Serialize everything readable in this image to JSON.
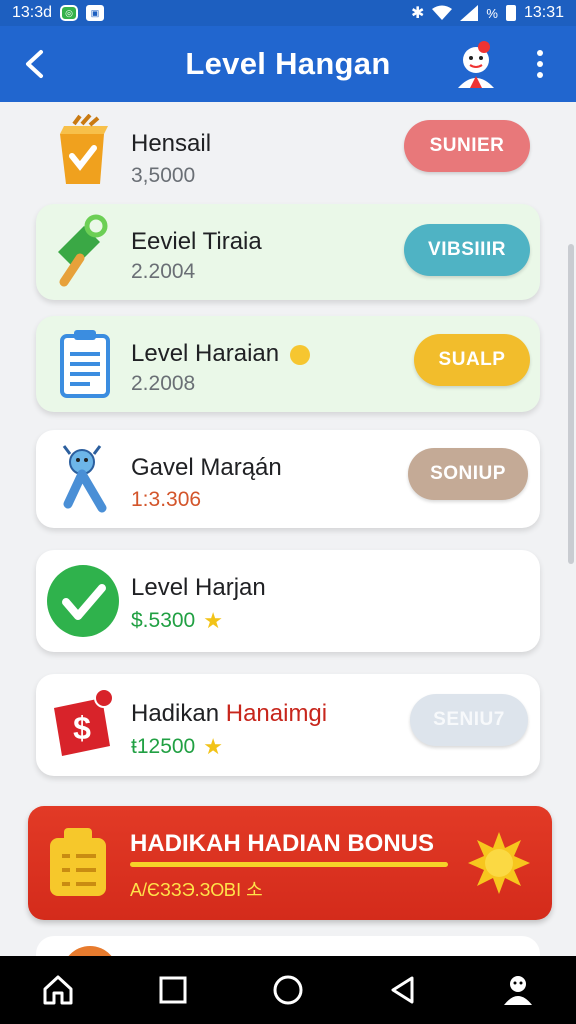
{
  "status_bar": {
    "time_left": "13:3d",
    "time_right": "13:31",
    "battery_text": "%"
  },
  "app_bar": {
    "title": "Level Hangan"
  },
  "cards": [
    {
      "title": "Hensail",
      "subtitle": "3,5000",
      "button": "SUNIER",
      "icon": "box-check-icon"
    },
    {
      "title": "Eeviel Tiraia",
      "subtitle": "2.2004",
      "button": "VIBSIIIR",
      "icon": "hammer-icon"
    },
    {
      "title": "Level Haraian",
      "subtitle": "2.2008",
      "button": "SUALP",
      "icon": "clipboard-icon"
    },
    {
      "title": "Gavel Marąán",
      "subtitle": "1:3.306",
      "button": "SONIUP",
      "icon": "character-icon"
    },
    {
      "title": "Level Harjan",
      "subtitle": "$.5300",
      "icon": "check-circle-icon"
    },
    {
      "title_main": "Hadikan ",
      "title_accent": "Hanaimgi",
      "subtitle": "ŧ12500",
      "button": "SENIU7",
      "icon": "dollar-icon"
    }
  ],
  "bonus": {
    "title": "HADIKAH HADIAN BONUS",
    "subtitle": "A/ЄЗЗЭ.ЗОᏴI 소"
  },
  "colors": {
    "appbar": "#2166cf",
    "pill_red": "#e8787a",
    "pill_teal": "#4fb3c4",
    "pill_yellow": "#f2bd2c",
    "pill_tan": "#c4aa96",
    "pill_grey": "#dde4ec",
    "bonus_red": "#db3220"
  }
}
